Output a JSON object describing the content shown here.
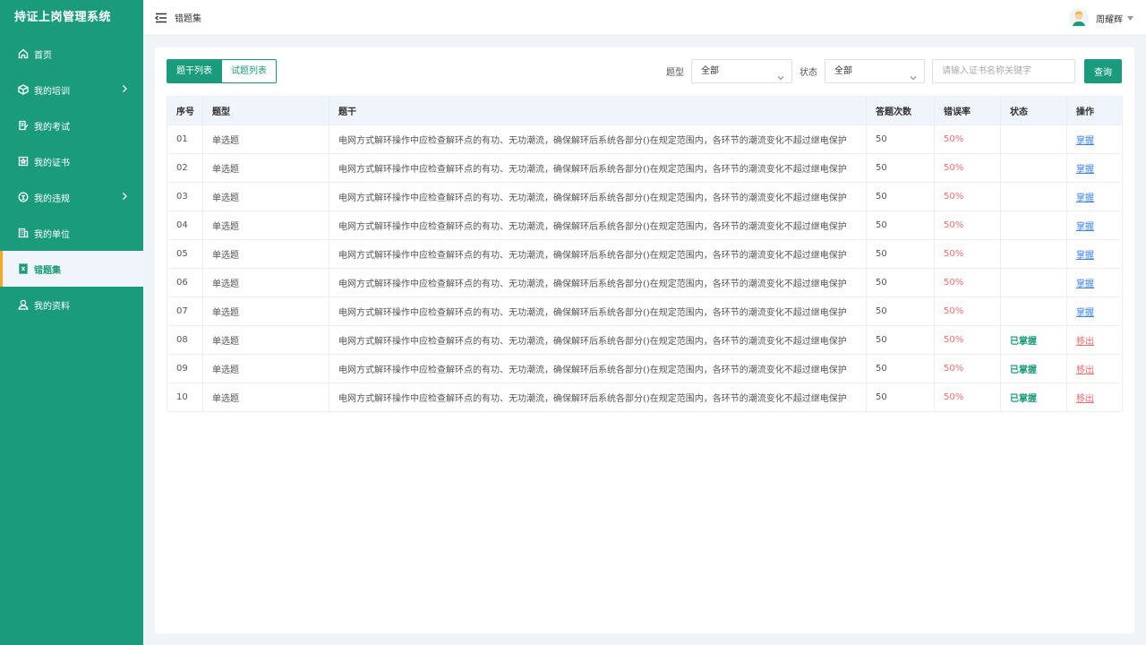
{
  "app": {
    "title": "持证上岗管理系统"
  },
  "sidebar": {
    "items": [
      {
        "label": "首页",
        "icon": "home-icon",
        "has_children": false,
        "active": false
      },
      {
        "label": "我的培训",
        "icon": "cube-icon",
        "has_children": true,
        "active": false
      },
      {
        "label": "我的考试",
        "icon": "exam-icon",
        "has_children": false,
        "active": false
      },
      {
        "label": "我的证书",
        "icon": "certificate-icon",
        "has_children": false,
        "active": false
      },
      {
        "label": "我的违规",
        "icon": "violation-icon",
        "has_children": true,
        "active": false
      },
      {
        "label": "我的单位",
        "icon": "building-icon",
        "has_children": false,
        "active": false
      },
      {
        "label": "错题集",
        "icon": "error-book-icon",
        "has_children": false,
        "active": true
      },
      {
        "label": "我的资料",
        "icon": "user-icon",
        "has_children": false,
        "active": false
      }
    ]
  },
  "header": {
    "page_title": "错题集",
    "user_name": "周耀辉"
  },
  "tabs": [
    {
      "label": "题干列表",
      "active": true
    },
    {
      "label": "试题列表",
      "active": false
    }
  ],
  "filters": {
    "type_label": "题型",
    "type_value": "全部",
    "status_label": "状态",
    "status_value": "全部",
    "search_placeholder": "请输入证书名称关键字",
    "query_label": "查询"
  },
  "table": {
    "columns": [
      "序号",
      "题型",
      "题干",
      "答题次数",
      "错误率",
      "状态",
      "操作"
    ],
    "rows": [
      {
        "index": "01",
        "type": "单选题",
        "stem": "电网方式解环操作中应检查解环点的有功、无功潮流，确保解环后系统各部分()在规定范围内，各环节的潮流变化不超过继电保护",
        "count": "50",
        "rate": "50%",
        "status": "",
        "action": "掌握"
      },
      {
        "index": "02",
        "type": "单选题",
        "stem": "电网方式解环操作中应检查解环点的有功、无功潮流，确保解环后系统各部分()在规定范围内，各环节的潮流变化不超过继电保护",
        "count": "50",
        "rate": "50%",
        "status": "",
        "action": "掌握"
      },
      {
        "index": "03",
        "type": "单选题",
        "stem": "电网方式解环操作中应检查解环点的有功、无功潮流，确保解环后系统各部分()在规定范围内，各环节的潮流变化不超过继电保护",
        "count": "50",
        "rate": "50%",
        "status": "",
        "action": "掌握"
      },
      {
        "index": "04",
        "type": "单选题",
        "stem": "电网方式解环操作中应检查解环点的有功、无功潮流，确保解环后系统各部分()在规定范围内，各环节的潮流变化不超过继电保护",
        "count": "50",
        "rate": "50%",
        "status": "",
        "action": "掌握"
      },
      {
        "index": "05",
        "type": "单选题",
        "stem": "电网方式解环操作中应检查解环点的有功、无功潮流，确保解环后系统各部分()在规定范围内，各环节的潮流变化不超过继电保护",
        "count": "50",
        "rate": "50%",
        "status": "",
        "action": "掌握"
      },
      {
        "index": "06",
        "type": "单选题",
        "stem": "电网方式解环操作中应检查解环点的有功、无功潮流，确保解环后系统各部分()在规定范围内，各环节的潮流变化不超过继电保护",
        "count": "50",
        "rate": "50%",
        "status": "",
        "action": "掌握"
      },
      {
        "index": "07",
        "type": "单选题",
        "stem": "电网方式解环操作中应检查解环点的有功、无功潮流，确保解环后系统各部分()在规定范围内，各环节的潮流变化不超过继电保护",
        "count": "50",
        "rate": "50%",
        "status": "",
        "action": "掌握"
      },
      {
        "index": "08",
        "type": "单选题",
        "stem": "电网方式解环操作中应检查解环点的有功、无功潮流，确保解环后系统各部分()在规定范围内，各环节的潮流变化不超过继电保护",
        "count": "50",
        "rate": "50%",
        "status": "已掌握",
        "action": "移出"
      },
      {
        "index": "09",
        "type": "单选题",
        "stem": "电网方式解环操作中应检查解环点的有功、无功潮流，确保解环后系统各部分()在规定范围内，各环节的潮流变化不超过继电保护",
        "count": "50",
        "rate": "50%",
        "status": "已掌握",
        "action": "移出"
      },
      {
        "index": "10",
        "type": "单选题",
        "stem": "电网方式解环操作中应检查解环点的有功、无功潮流，确保解环后系统各部分()在规定范围内，各环节的潮流变化不超过继电保护",
        "count": "50",
        "rate": "50%",
        "status": "已掌握",
        "action": "移出"
      }
    ]
  },
  "colors": {
    "primary": "#1a9c7c",
    "active_marker": "#f5a623",
    "rate_red": "#f56c6c",
    "link_blue": "#3b82f6"
  }
}
